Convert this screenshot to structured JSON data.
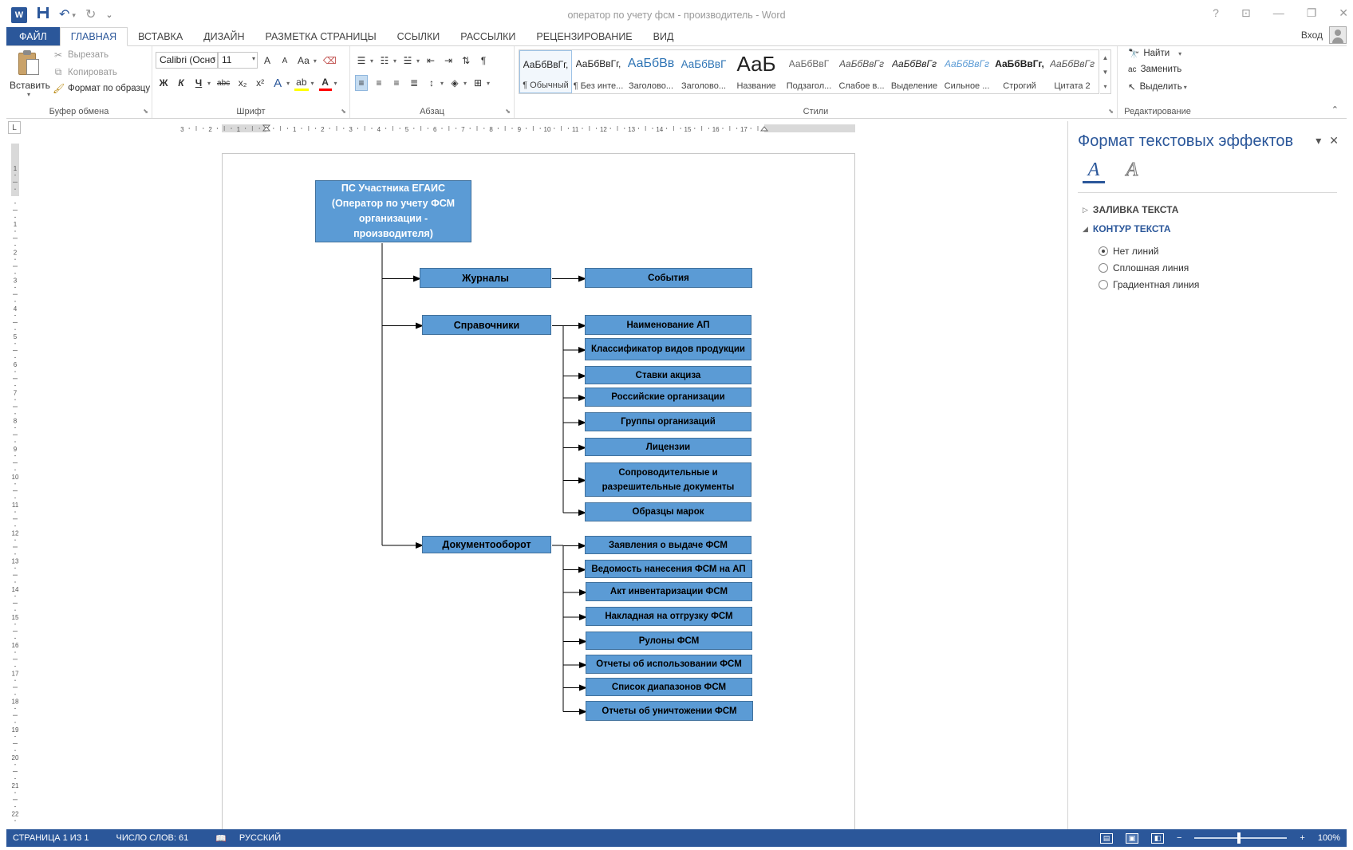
{
  "window": {
    "title": "оператор по учету фсм - производитель - Word",
    "help": "?",
    "restore_ribbon": "⊡",
    "minimize": "—",
    "maximize": "❐",
    "close": "✕"
  },
  "qat": {
    "word_logo": "W",
    "save": "💾",
    "undo": "↶",
    "redo": "↻",
    "customize": "⌄"
  },
  "tabs": [
    {
      "label": "ФАЙЛ"
    },
    {
      "label": "ГЛАВНАЯ"
    },
    {
      "label": "ВСТАВКА"
    },
    {
      "label": "ДИЗАЙН"
    },
    {
      "label": "РАЗМЕТКА СТРАНИЦЫ"
    },
    {
      "label": "ССЫЛКИ"
    },
    {
      "label": "РАССЫЛКИ"
    },
    {
      "label": "РЕЦЕНЗИРОВАНИЕ"
    },
    {
      "label": "ВИД"
    }
  ],
  "signin_label": "Вход",
  "ribbon": {
    "clipboard": {
      "label": "Буфер обмена",
      "paste": "Вставить",
      "cut": "Вырезать",
      "copy": "Копировать",
      "format_painter": "Формат по образцу"
    },
    "font": {
      "label": "Шрифт",
      "font_name": "Calibri (Осно",
      "font_size": "11",
      "grow": "A",
      "shrink": "A",
      "change_case": "Аа",
      "bold": "Ж",
      "italic": "К",
      "underline": "Ч",
      "strike": "abc",
      "subscript": "x₂",
      "superscript": "x²",
      "text_effects": "A",
      "highlight": "ab",
      "font_color": "A"
    },
    "paragraph": {
      "label": "Абзац"
    },
    "styles": {
      "label": "Стили",
      "items": [
        {
          "sample": "АаБбВвГг,",
          "name": "¶ Обычный"
        },
        {
          "sample": "АаБбВвГг,",
          "name": "¶ Без инте..."
        },
        {
          "sample": "АаБбВв",
          "name": "Заголово..."
        },
        {
          "sample": "АаБбВвГ",
          "name": "Заголово..."
        },
        {
          "sample": "АаБ",
          "name": "Название"
        },
        {
          "sample": "АаБбВвГ",
          "name": "Подзагол..."
        },
        {
          "sample": "АаБбВвГг",
          "name": "Слабое в..."
        },
        {
          "sample": "АаБбВвГг",
          "name": "Выделение"
        },
        {
          "sample": "АаБбВвГг",
          "name": "Сильное ..."
        },
        {
          "sample": "АаБбВвГг,",
          "name": "Строгий"
        },
        {
          "sample": "АаБбВвГг",
          "name": "Цитата 2"
        }
      ]
    },
    "editing": {
      "label": "Редактирование",
      "find": "Найти",
      "replace": "Заменить",
      "select": "Выделить"
    }
  },
  "ruler_corner": "L",
  "diagram": {
    "root": "ПС Участника ЕГАИС (Оператор по учету ФСМ организации - производителя)",
    "journals": "Журналы",
    "events": "События",
    "directories": "Справочники",
    "dir_items": [
      "Наименование АП",
      "Классификатор видов продукции",
      "Ставки акциза",
      "Российские организации",
      "Группы организаций",
      "Лицензии",
      "Сопроводительные и разрешительные документы",
      "Образцы марок"
    ],
    "docflow": "Документооборот",
    "doc_items": [
      "Заявления о выдаче ФСМ",
      "Ведомость нанесения ФСМ на АП",
      "Акт инвентаризации ФСМ",
      "Накладная на отгрузку ФСМ",
      "Рулоны ФСМ",
      "Отчеты об использовании ФСМ",
      "Список диапазонов ФСМ",
      "Отчеты об уничтожении ФСМ"
    ]
  },
  "pane": {
    "title": "Формат текстовых эффектов",
    "tab_fill": "A",
    "tab_outline": "A",
    "section_fill": "ЗАЛИВКА ТЕКСТА",
    "section_outline": "КОНТУР ТЕКСТА",
    "options": [
      "Нет линий",
      "Сплошная линия",
      "Градиентная линия"
    ],
    "selected_option": "Нет линий"
  },
  "status": {
    "page": "СТРАНИЦА 1 ИЗ 1",
    "words": "ЧИСЛО СЛОВ: 61",
    "language": "РУССКИЙ",
    "zoom": "100%"
  },
  "colors": {
    "accent": "#2b579a",
    "node_fill": "#5b9bd5",
    "node_border": "#41719c"
  }
}
